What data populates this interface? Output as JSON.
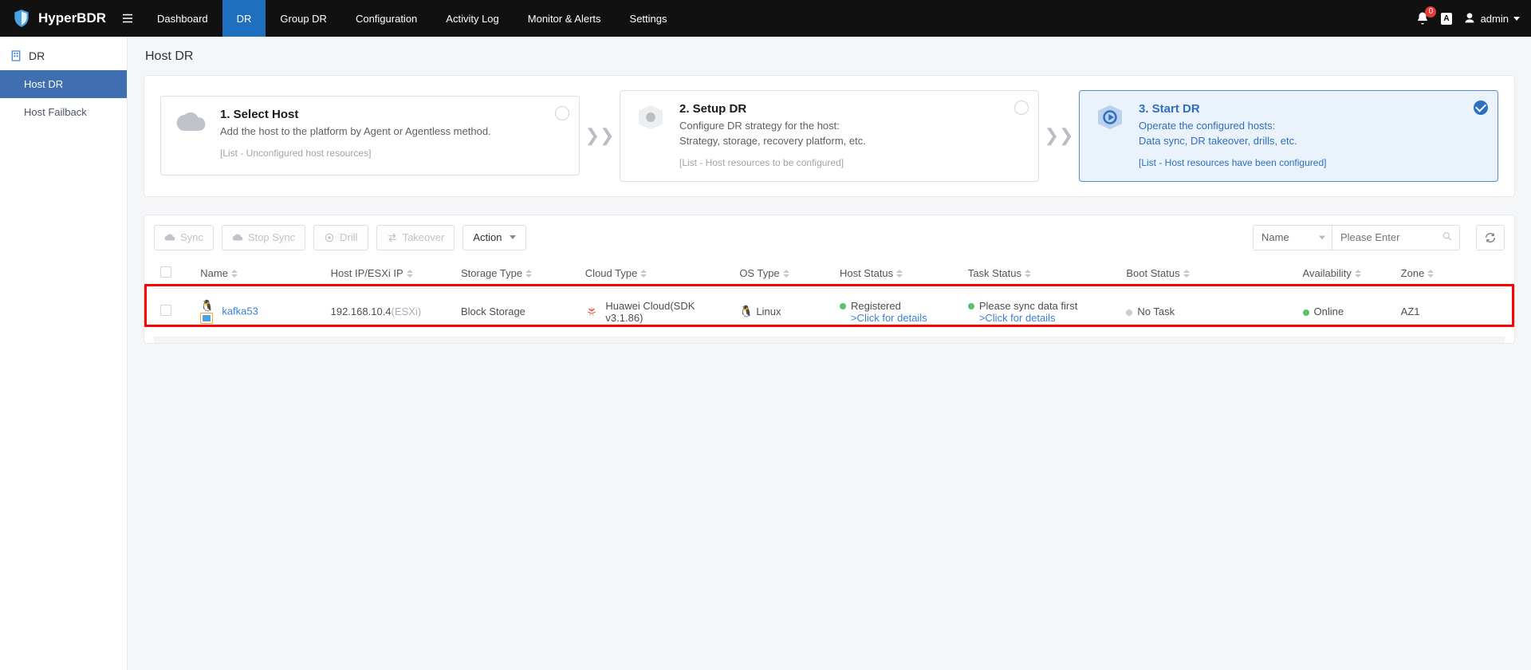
{
  "brand": "HyperBDR",
  "nav": {
    "items": [
      "Dashboard",
      "DR",
      "Group DR",
      "Configuration",
      "Activity Log",
      "Monitor & Alerts",
      "Settings"
    ],
    "active_index": 1
  },
  "topbar": {
    "notif_count": "0",
    "lang_badge": "A",
    "user": "admin"
  },
  "sidebar": {
    "group": "DR",
    "items": [
      "Host DR",
      "Host Failback"
    ],
    "active_index": 0
  },
  "page_title": "Host DR",
  "steps": [
    {
      "title": "1. Select Host",
      "desc": "Add the host to the platform by Agent or Agentless method.",
      "hint": "[List - Unconfigured host resources]",
      "active": false
    },
    {
      "title": "2. Setup DR",
      "desc": "Configure DR strategy for the host:\nStrategy, storage, recovery platform, etc.",
      "hint": "[List - Host resources to be configured]",
      "active": false
    },
    {
      "title": "3. Start DR",
      "desc": "Operate the configured hosts:\nData sync, DR takeover, drills, etc.",
      "hint": "[List - Host resources have been configured]",
      "active": true
    }
  ],
  "toolbar": {
    "sync": "Sync",
    "stop_sync": "Stop Sync",
    "drill": "Drill",
    "takeover": "Takeover",
    "action": "Action",
    "filter_field": "Name",
    "search_placeholder": "Please Enter"
  },
  "table": {
    "headers": {
      "name": "Name",
      "ip": "Host IP/ESXi IP",
      "storage": "Storage Type",
      "cloud": "Cloud Type",
      "os": "OS Type",
      "host_status": "Host Status",
      "task_status": "Task Status",
      "boot_status": "Boot Status",
      "availability": "Availability",
      "zone": "Zone"
    },
    "row": {
      "name": "kafka53",
      "ip": "192.168.10.4",
      "ip_suffix": "(ESXi)",
      "storage": "Block Storage",
      "cloud_line1": "Huawei Cloud(SDK",
      "cloud_line2": "v3.1.86)",
      "os": "Linux",
      "host_status": "Registered",
      "host_status_link": ">Click for details",
      "task_status": "Please sync data first",
      "task_status_link": ">Click for details",
      "boot_status": "No Task",
      "availability": "Online",
      "zone": "AZ1"
    }
  }
}
